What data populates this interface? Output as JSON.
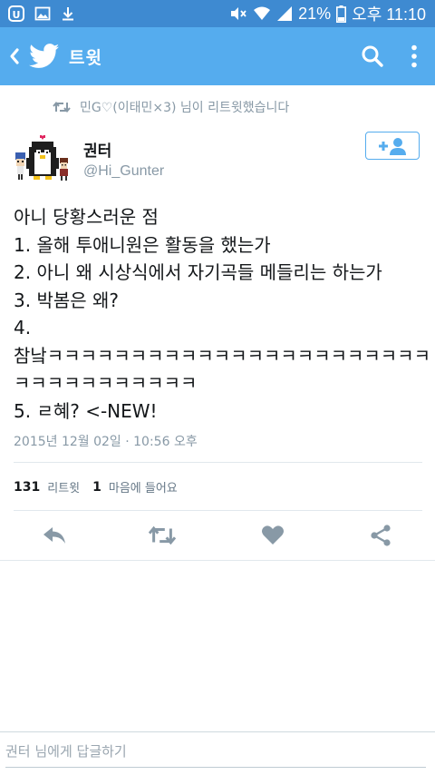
{
  "status_bar": {
    "battery": "21%",
    "time": "오후 11:10"
  },
  "app_bar": {
    "title": "트윗"
  },
  "tweet": {
    "retweet_context": "민G♡(이태민×3) 님이 리트윗했습니다",
    "author": {
      "name": "권터",
      "handle": "@Hi_Gunter"
    },
    "text_lines": [
      "아니 당황스러운 점",
      "1. 올해 투애니원은 활동을 했는가",
      "2. 아니 왜 시상식에서 자기곡들 메들리는 하는가",
      "3. 박봄은 왜?",
      "4.",
      "참낰ㅋㅋㅋㅋㅋㅋㅋㅋㅋㅋㅋㅋㅋㅋㅋㅋㅋㅋㅋㅋㅋㅋㅋ",
      "ㅋㅋㅋㅋㅋㅋㅋㅋㅋㅋㅋ",
      "5. ㄹ혜? <-NEW!"
    ],
    "timestamp": "2015년 12월 02일 · 10:56 오후",
    "stats": {
      "retweets_count": "131",
      "retweets_label": "리트윗",
      "likes_count": "1",
      "likes_label": "마음에 들어요"
    }
  },
  "reply": {
    "placeholder": "권터 님에게 답글하기"
  },
  "colors": {
    "brand": "#55acee",
    "status_bar": "#3e8ad1",
    "muted": "#8899a6",
    "icon": "#8899a6"
  }
}
